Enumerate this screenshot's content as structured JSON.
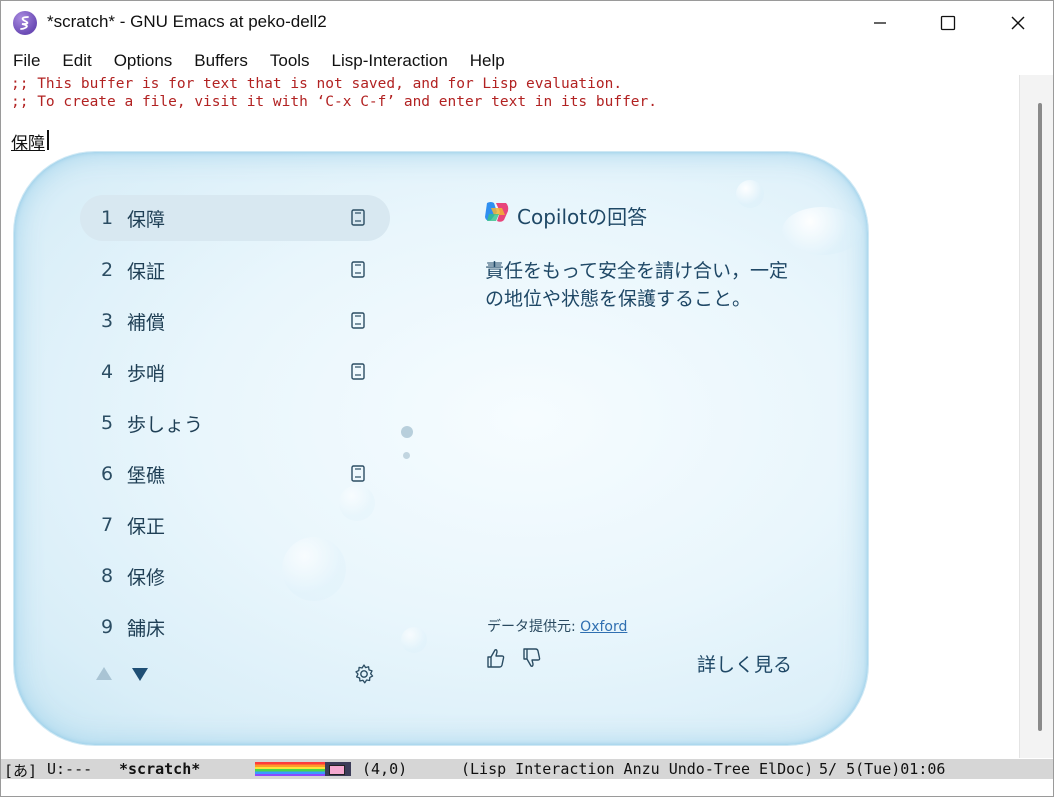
{
  "window": {
    "title": "*scratch* - GNU Emacs at peko-dell2"
  },
  "menu": [
    "File",
    "Edit",
    "Options",
    "Buffers",
    "Tools",
    "Lisp-Interaction",
    "Help"
  ],
  "editor": {
    "comment_line1": ";; This buffer is for text that is not saved, and for Lisp evaluation.",
    "comment_line2": ";; To create a file, visit it with ‘C-x C-f’ and enter text in its buffer.",
    "typed_text": "保障"
  },
  "ime": {
    "candidates": [
      {
        "num": "1",
        "word": "保障",
        "has_dict": true,
        "selected": true
      },
      {
        "num": "2",
        "word": "保証",
        "has_dict": true
      },
      {
        "num": "3",
        "word": "補償",
        "has_dict": true
      },
      {
        "num": "4",
        "word": "歩哨",
        "has_dict": true
      },
      {
        "num": "5",
        "word": "歩しょう",
        "has_dict": false
      },
      {
        "num": "6",
        "word": "堡礁",
        "has_dict": true
      },
      {
        "num": "7",
        "word": "保正",
        "has_dict": false
      },
      {
        "num": "8",
        "word": "保修",
        "has_dict": false
      },
      {
        "num": "9",
        "word": "舗床",
        "has_dict": false
      }
    ],
    "copilot_title": "Copilotの回答",
    "answer": "責任をもって安全を請け合い，一定の地位や状態を保護すること。",
    "source_label": "データ提供元: ",
    "source_link": "Oxford",
    "more_label": "詳しく見る"
  },
  "modeline": {
    "ime_mode": "[あ]",
    "status": "U:---",
    "buffer": "*scratch*",
    "position": "(4,0)",
    "modes": "(Lisp Interaction Anzu Undo-Tree ElDoc)",
    "datetime": "5/ 5(Tue)01:06"
  },
  "colors": {
    "comment": "#b22222",
    "ime_text": "#1f4866",
    "selection": "#d8e8f1",
    "modeline_bg": "#d6d6d6"
  }
}
